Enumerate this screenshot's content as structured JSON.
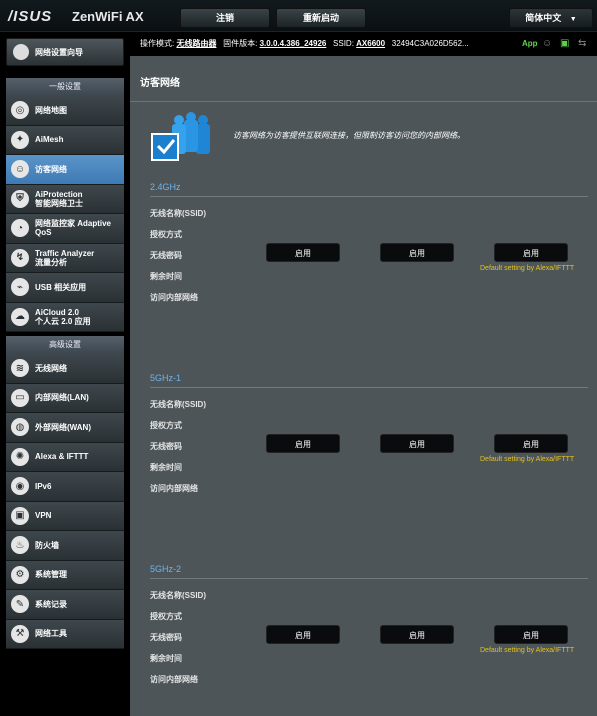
{
  "header": {
    "logo": "/ISUS",
    "product": "ZenWiFi AX",
    "logout_label": "注销",
    "reboot_label": "重新启动",
    "language_label": "简体中文"
  },
  "status": {
    "mode_label": "操作模式:",
    "mode_value": "无线路由器",
    "firmware_label": "固件版本:",
    "firmware_value": "3.0.0.4.386_24926",
    "ssid_label": "SSID:",
    "ssid_value": "AX6600",
    "ssid_more": "32494C3A026D562...",
    "app_label": "App"
  },
  "sidebar": {
    "wizard_label": "网络设置向导",
    "general_header": "一般设置",
    "general_items": [
      {
        "label": "网络地图",
        "icon": "globe-icon"
      },
      {
        "label": "AiMesh",
        "icon": "mesh-icon"
      },
      {
        "label": "访客网络",
        "icon": "guest-icon",
        "selected": true
      },
      {
        "label": "AiProtection",
        "label2": "智能网络卫士",
        "icon": "shield-icon"
      },
      {
        "label": "网络监控家 Adaptive",
        "label2": "QoS",
        "icon": "gauge-icon"
      },
      {
        "label": "Traffic Analyzer",
        "label2": "流量分析",
        "icon": "traffic-icon"
      },
      {
        "label": "USB 相关应用",
        "icon": "usb-icon"
      },
      {
        "label": "AiCloud 2.0",
        "label2": "个人云 2.0 应用",
        "icon": "cloud-icon"
      }
    ],
    "advanced_header": "高级设置",
    "advanced_items": [
      {
        "label": "无线网络",
        "icon": "wifi-icon"
      },
      {
        "label": "内部网络(LAN)",
        "icon": "lan-icon"
      },
      {
        "label": "外部网络(WAN)",
        "icon": "wan-icon"
      },
      {
        "label": "Alexa & IFTTT",
        "icon": "alexa-icon"
      },
      {
        "label": "IPv6",
        "icon": "ipv6-icon"
      },
      {
        "label": "VPN",
        "icon": "vpn-icon"
      },
      {
        "label": "防火墙",
        "icon": "firewall-icon"
      },
      {
        "label": "系统管理",
        "icon": "admin-icon"
      },
      {
        "label": "系统记录",
        "icon": "log-icon"
      },
      {
        "label": "网络工具",
        "icon": "tools-icon"
      }
    ]
  },
  "main": {
    "title": "访客网络",
    "intro": "访客网络为访客提供互联网连接，但限制访客访问您的内部网络。",
    "row_labels": [
      "无线名称(SSID)",
      "授权方式",
      "无线密码",
      "剩余时间",
      "访问内部网络"
    ],
    "enable_label": "启用",
    "default_note": "Default setting by Alexa/IFTTT",
    "bands": [
      "2.4GHz",
      "5GHz-1",
      "5GHz-2"
    ]
  }
}
